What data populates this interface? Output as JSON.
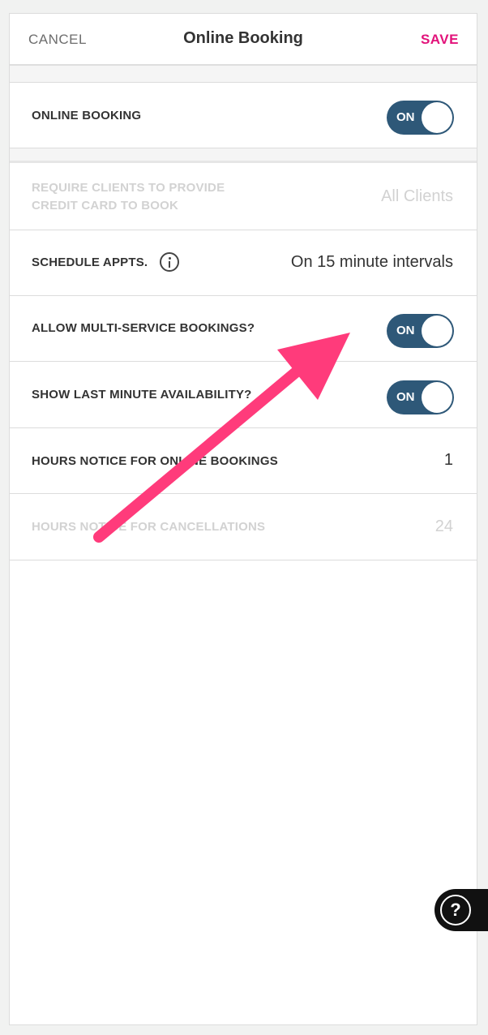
{
  "header": {
    "cancel_label": "CANCEL",
    "title": "Online Booking",
    "save_label": "SAVE"
  },
  "settings": {
    "online_booking": {
      "label": "ONLINE BOOKING",
      "toggle": "ON"
    },
    "require_card": {
      "label_line1": "REQUIRE CLIENTS TO PROVIDE",
      "label_line2": "CREDIT CARD TO BOOK",
      "value": "All Clients"
    },
    "schedule_appts": {
      "label": "SCHEDULE APPTS.",
      "value": "On 15 minute intervals"
    },
    "multi_service": {
      "label": "ALLOW MULTI-SERVICE BOOKINGS?",
      "toggle": "ON"
    },
    "last_minute": {
      "label": "SHOW LAST MINUTE AVAILABILITY?",
      "toggle": "ON"
    },
    "hours_notice_booking": {
      "label": "HOURS NOTICE FOR ONLINE BOOKINGS",
      "value": "1"
    },
    "hours_notice_cancel": {
      "label": "HOURS NOTICE FOR CANCELLATIONS",
      "value": "24"
    }
  },
  "help": {
    "label": "?"
  },
  "colors": {
    "accent_save": "#e2127a",
    "toggle_on": "#2e5878",
    "annotation_arrow": "#ff3b7b"
  }
}
